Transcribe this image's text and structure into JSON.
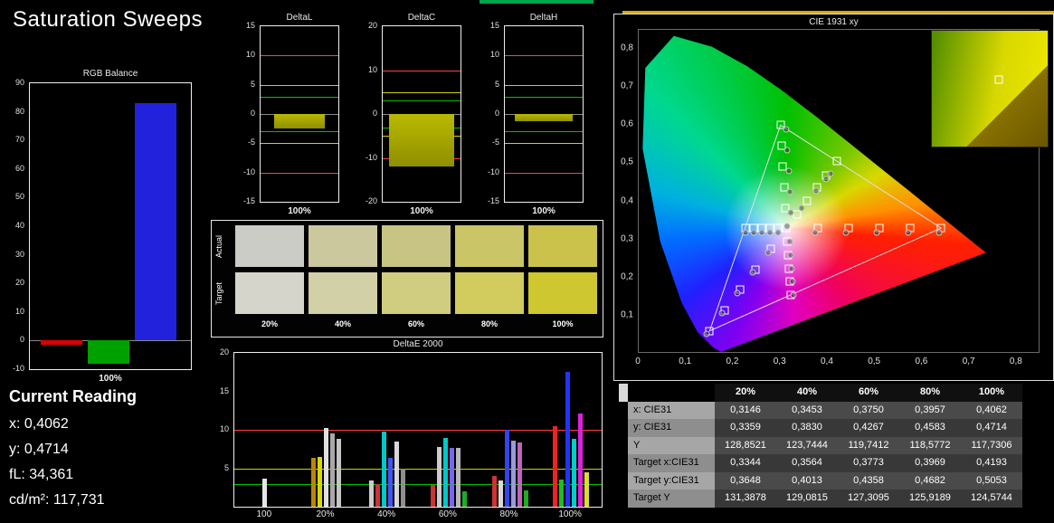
{
  "title": "Saturation Sweeps",
  "current_reading": {
    "heading": "Current Reading",
    "lines": [
      "x: 0,4062",
      "y: 0,4714",
      "fL: 34,361",
      "cd/m²: 117,731"
    ]
  },
  "swatches": {
    "row_labels": [
      "Actual",
      "Target"
    ],
    "col_labels": [
      "20%",
      "40%",
      "60%",
      "80%",
      "100%"
    ],
    "actual": [
      "#cbccc6",
      "#cbc89e",
      "#c8c484",
      "#cac566",
      "#cac24b"
    ],
    "target": [
      "#d5d5cb",
      "#d1d0a6",
      "#d1cd80",
      "#d2cc5e",
      "#cfc72f"
    ]
  },
  "table": {
    "headers": [
      "",
      "20%",
      "40%",
      "60%",
      "80%",
      "100%"
    ],
    "rows": [
      {
        "label": "x: CIE31",
        "values": [
          "0,3146",
          "0,3453",
          "0,3750",
          "0,3957",
          "0,4062"
        ]
      },
      {
        "label": "y: CIE31",
        "values": [
          "0,3359",
          "0,3830",
          "0,4267",
          "0,4583",
          "0,4714"
        ]
      },
      {
        "label": "Y",
        "values": [
          "128,8521",
          "123,7444",
          "119,7412",
          "118,5772",
          "117,7306"
        ]
      },
      {
        "label": "Target x:CIE31",
        "values": [
          "0,3344",
          "0,3564",
          "0,3773",
          "0,3969",
          "0,4193"
        ]
      },
      {
        "label": "Target y:CIE31",
        "values": [
          "0,3648",
          "0,4013",
          "0,4358",
          "0,4682",
          "0,5053"
        ]
      },
      {
        "label": "Target Y",
        "values": [
          "131,3878",
          "129,0815",
          "127,3095",
          "125,9189",
          "124,5744"
        ]
      }
    ]
  },
  "chart_data": [
    {
      "id": "rgb_balance",
      "type": "bar",
      "title": "RGB Balance",
      "ylim": [
        -10,
        90
      ],
      "yticks": [
        90,
        80,
        70,
        60,
        50,
        40,
        30,
        20,
        10,
        0,
        -10
      ],
      "xlabel": "100%",
      "categories": [
        "100%"
      ],
      "series": [
        {
          "name": "red",
          "color": "#dd0000",
          "values": [
            -1.5
          ]
        },
        {
          "name": "green",
          "color": "#00a000",
          "values": [
            -8
          ]
        },
        {
          "name": "blue",
          "color": "#2222dd",
          "values": [
            83
          ]
        }
      ]
    },
    {
      "id": "deltaL",
      "type": "bar",
      "title": "DeltaL",
      "ylim": [
        -15,
        15
      ],
      "yticks": [
        15,
        10,
        5,
        0,
        -5,
        -10,
        -15
      ],
      "xlabel": "100%",
      "value": -2.5,
      "bar_color": "#b9b900",
      "ref_lines": [
        {
          "y": 10,
          "color": "#ff4040"
        },
        {
          "y": 5,
          "color": "#d0d000"
        },
        {
          "y": 3,
          "color": "#00c000"
        },
        {
          "y": -3,
          "color": "#00c000"
        },
        {
          "y": -5,
          "color": "#d0d000"
        },
        {
          "y": -10,
          "color": "#ff4040"
        }
      ]
    },
    {
      "id": "deltaC",
      "type": "bar",
      "title": "DeltaC",
      "ylim": [
        -20,
        20
      ],
      "yticks": [
        20,
        10,
        0,
        -10,
        -20
      ],
      "xlabel": "100%",
      "value": -12,
      "bar_color": "#b9b900",
      "ref_lines": [
        {
          "y": 10,
          "color": "#ff4040"
        },
        {
          "y": 5,
          "color": "#d0d000"
        },
        {
          "y": 3,
          "color": "#00c000"
        },
        {
          "y": -3,
          "color": "#00c000"
        },
        {
          "y": -5,
          "color": "#d0d000"
        },
        {
          "y": -10,
          "color": "#ff4040"
        }
      ]
    },
    {
      "id": "deltaH",
      "type": "bar",
      "title": "DeltaH",
      "ylim": [
        -15,
        15
      ],
      "yticks": [
        15,
        10,
        5,
        0,
        -5,
        -10,
        -15
      ],
      "xlabel": "100%",
      "value": -1.2,
      "bar_color": "#b9b900",
      "ref_lines": [
        {
          "y": 10,
          "color": "#ff4040"
        },
        {
          "y": 5,
          "color": "#d0d000"
        },
        {
          "y": 3,
          "color": "#00c000"
        },
        {
          "y": -3,
          "color": "#00c000"
        },
        {
          "y": -5,
          "color": "#d0d000"
        },
        {
          "y": -10,
          "color": "#ff4040"
        }
      ]
    },
    {
      "id": "deltaE2000",
      "type": "grouped-bar",
      "title": "DeltaE 2000",
      "ylim": [
        0,
        20
      ],
      "yticks": [
        20,
        15,
        10,
        5
      ],
      "ref_lines": [
        {
          "y": 10,
          "color": "#ff4040"
        },
        {
          "y": 5,
          "color": "#d0d000"
        },
        {
          "y": 3,
          "color": "#00c000"
        }
      ],
      "groups": [
        {
          "label": "100",
          "bars": [
            {
              "color": "#e6e6e6",
              "value": 3.6
            }
          ]
        },
        {
          "label": "20%",
          "bars": [
            {
              "color": "#b8860b",
              "value": 6.3
            },
            {
              "color": "#d8d800",
              "value": 6.5
            },
            {
              "color": "#e0e0e0",
              "value": 10.2
            },
            {
              "color": "#a8a8a8",
              "value": 9.5
            },
            {
              "color": "#c4c4c4",
              "value": 8.8
            }
          ]
        },
        {
          "label": "40%",
          "bars": [
            {
              "color": "#cccccc",
              "value": 3.4
            },
            {
              "color": "#cc3333",
              "value": 2.9
            },
            {
              "color": "#00c8c8",
              "value": 9.8
            },
            {
              "color": "#4455ee",
              "value": 6.3
            },
            {
              "color": "#d8d8d8",
              "value": 8.5
            },
            {
              "color": "#8f8f8f",
              "value": 4.9
            }
          ]
        },
        {
          "label": "60%",
          "bars": [
            {
              "color": "#cc3333",
              "value": 2.8
            },
            {
              "color": "#cccccc",
              "value": 7.8
            },
            {
              "color": "#00c8c8",
              "value": 9.0
            },
            {
              "color": "#7766ee",
              "value": 7.7
            },
            {
              "color": "#b8b8b8",
              "value": 7.6
            },
            {
              "color": "#22aa22",
              "value": 2.0
            }
          ]
        },
        {
          "label": "80%",
          "bars": [
            {
              "color": "#cc3333",
              "value": 4.0
            },
            {
              "color": "#d8d8d8",
              "value": 3.4
            },
            {
              "color": "#3344ee",
              "value": 10.0
            },
            {
              "color": "#9999dd",
              "value": 8.6
            },
            {
              "color": "#bb66bb",
              "value": 8.4
            },
            {
              "color": "#22aa22",
              "value": 2.1
            }
          ]
        },
        {
          "label": "100%",
          "bars": [
            {
              "color": "#ee2222",
              "value": 10.5
            },
            {
              "color": "#22bb22",
              "value": 3.5
            },
            {
              "color": "#2233ff",
              "value": 17.5
            },
            {
              "color": "#00cccc",
              "value": 8.8
            },
            {
              "color": "#dd22dd",
              "value": 12.1
            },
            {
              "color": "#dddd22",
              "value": 4.5
            }
          ]
        }
      ]
    },
    {
      "id": "cie1931",
      "type": "scatter",
      "title": "CIE 1931 xy",
      "xlim": [
        0,
        0.85
      ],
      "ylim": [
        0,
        0.85
      ],
      "x_tick_labels": [
        "0",
        "0,1",
        "0,2",
        "0,3",
        "0,4",
        "0,5",
        "0,6",
        "0,7",
        "0,8"
      ],
      "x_tick_values": [
        0,
        0.1,
        0.2,
        0.3,
        0.4,
        0.5,
        0.6,
        0.7,
        0.8
      ],
      "y_tick_labels": [
        "0,8",
        "0,7",
        "0,6",
        "0,5",
        "0,4",
        "0,3",
        "0,2",
        "0,1"
      ],
      "y_tick_values": [
        0.8,
        0.7,
        0.6,
        0.5,
        0.4,
        0.3,
        0.2,
        0.1
      ],
      "triangle_rgb": [
        [
          0.64,
          0.33
        ],
        [
          0.3,
          0.6
        ],
        [
          0.15,
          0.06
        ]
      ],
      "target_squares": {
        "white": [
          [
            0.3127,
            0.329
          ]
        ],
        "red": [
          [
            0.3782,
            0.3292
          ],
          [
            0.4436,
            0.3294
          ],
          [
            0.5091,
            0.3296
          ],
          [
            0.5745,
            0.3298
          ],
          [
            0.64,
            0.33
          ]
        ],
        "green": [
          [
            0.3102,
            0.3832
          ],
          [
            0.3076,
            0.4374
          ],
          [
            0.3051,
            0.4916
          ],
          [
            0.3025,
            0.5458
          ],
          [
            0.3,
            0.6
          ]
        ],
        "blue": [
          [
            0.2802,
            0.2752
          ],
          [
            0.2476,
            0.2214
          ],
          [
            0.2151,
            0.1676
          ],
          [
            0.1825,
            0.1138
          ],
          [
            0.15,
            0.06
          ]
        ],
        "cyan": [
          [
            0.2952,
            0.329
          ],
          [
            0.2776,
            0.329
          ],
          [
            0.2601,
            0.329
          ],
          [
            0.2425,
            0.329
          ],
          [
            0.225,
            0.329
          ]
        ],
        "magenta": [
          [
            0.3143,
            0.294
          ],
          [
            0.316,
            0.259
          ],
          [
            0.3176,
            0.2241
          ],
          [
            0.3193,
            0.1891
          ],
          [
            0.3209,
            0.1542
          ]
        ],
        "yellow": [
          [
            0.3344,
            0.3648
          ],
          [
            0.3564,
            0.4013
          ],
          [
            0.3773,
            0.4358
          ],
          [
            0.3969,
            0.4682
          ],
          [
            0.4193,
            0.5053
          ]
        ]
      },
      "measured_circles": {
        "yellow": [
          [
            0.3146,
            0.3359
          ],
          [
            0.3453,
            0.383
          ],
          [
            0.375,
            0.4267
          ],
          [
            0.3957,
            0.4583
          ],
          [
            0.4062,
            0.4714
          ]
        ],
        "red": [
          [
            0.373,
            0.317
          ],
          [
            0.439,
            0.317
          ],
          [
            0.504,
            0.318
          ],
          [
            0.57,
            0.318
          ],
          [
            0.635,
            0.318
          ]
        ],
        "green": [
          [
            0.322,
            0.371
          ],
          [
            0.32,
            0.425
          ],
          [
            0.317,
            0.48
          ],
          [
            0.314,
            0.534
          ],
          [
            0.312,
            0.588
          ]
        ],
        "blue": [
          [
            0.274,
            0.267
          ],
          [
            0.242,
            0.213
          ],
          [
            0.209,
            0.16
          ],
          [
            0.177,
            0.106
          ],
          [
            0.144,
            0.052
          ]
        ],
        "cyan": [
          [
            0.295,
            0.319
          ],
          [
            0.278,
            0.319
          ],
          [
            0.26,
            0.319
          ],
          [
            0.243,
            0.319
          ],
          [
            0.225,
            0.319
          ]
        ],
        "magenta": [
          [
            0.32,
            0.294
          ],
          [
            0.322,
            0.259
          ],
          [
            0.323,
            0.224
          ],
          [
            0.325,
            0.189
          ],
          [
            0.327,
            0.154
          ]
        ]
      },
      "inset_marker": {
        "left_pct": 58,
        "top_pct": 42
      }
    }
  ]
}
